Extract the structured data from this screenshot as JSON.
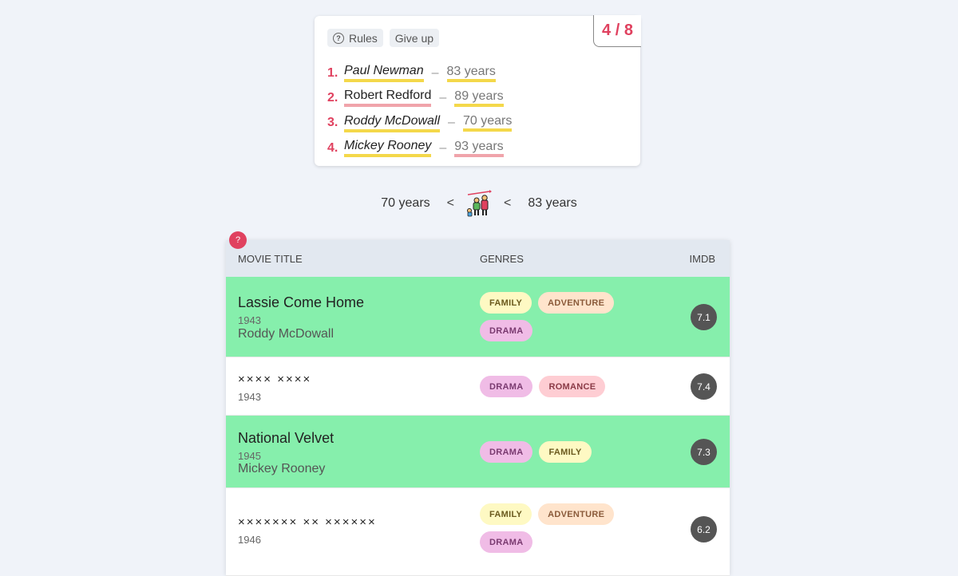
{
  "score": "4 / 8",
  "toolbar": {
    "rules_label": "Rules",
    "giveup_label": "Give up"
  },
  "guesses": [
    {
      "num": "1.",
      "name": "Paul Newman",
      "years": "83 years"
    },
    {
      "num": "2.",
      "name": "Robert Redford",
      "years": "89 years"
    },
    {
      "num": "3.",
      "name": "Roddy McDowall",
      "years": "70 years"
    },
    {
      "num": "4.",
      "name": "Mickey Rooney",
      "years": "93 years"
    }
  ],
  "compare": {
    "lower": "70 years",
    "lt1": "<",
    "lt2": "<",
    "upper": "83 years"
  },
  "table": {
    "help": "?",
    "headers": {
      "title": "MOVIE TITLE",
      "genres": "GENRES",
      "imdb": "IMDB"
    },
    "rows": [
      {
        "title": "Lassie Come Home",
        "year": "1943",
        "actor": "Roddy McDowall",
        "genres": [
          "FAMILY",
          "ADVENTURE",
          "DRAMA"
        ],
        "imdb": "7.1"
      },
      {
        "title": "×××× ××××",
        "year": "1943",
        "actor": "",
        "genres": [
          "DRAMA",
          "ROMANCE"
        ],
        "imdb": "7.4"
      },
      {
        "title": "National Velvet",
        "year": "1945",
        "actor": "Mickey Rooney",
        "genres": [
          "DRAMA",
          "FAMILY"
        ],
        "imdb": "7.3"
      },
      {
        "title": "××××××× ×× ××××××",
        "year": "1946",
        "actor": "",
        "genres": [
          "FAMILY",
          "ADVENTURE",
          "DRAMA"
        ],
        "imdb": "6.2"
      }
    ]
  },
  "colors": {
    "accent": "#e0415f",
    "match_row": "#86efac",
    "header_bg": "#e2e8f0"
  }
}
